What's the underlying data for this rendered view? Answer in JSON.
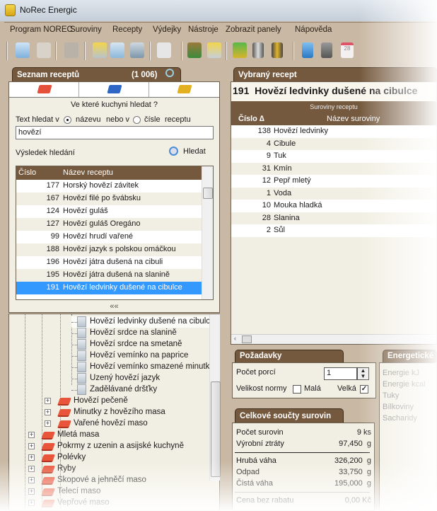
{
  "window": {
    "title": "NoRec Energic"
  },
  "menu": [
    "Program NOREC",
    "Suroviny",
    "Recepty",
    "Výdejky",
    "Nástroje",
    "Zobrazit panely",
    "Nápověda"
  ],
  "toolbar": {
    "icons": [
      "import-icon",
      "preview-icon",
      "print-check-icon",
      "jar-refresh-icon",
      "doc-import-icon",
      "jar-upload-icon",
      "printer-check-icon",
      "vegetables-icon",
      "jar-check-icon",
      "money-icon",
      "battery-check-icon",
      "battery-icon",
      "calculator-blue-icon",
      "calculator-gray-icon",
      "calendar-icon"
    ],
    "calendar_day": "28"
  },
  "left": {
    "title": "Seznam receptů",
    "count": "(1 006)",
    "kitchen_question": "Ve které kuchyni hledat ?",
    "search_in_label": "Text hledat v",
    "radio_name": "názevu",
    "or_label": "nebo v",
    "radio_number": "čísle",
    "recipe_word": "receptu",
    "search_value": "hovězí",
    "results_label": "Výsledek hledání",
    "search_button": "Hledat",
    "columns": [
      "Číslo",
      "Název receptu"
    ],
    "results": [
      {
        "num": "177",
        "name": "Horský hovězí závitek"
      },
      {
        "num": "167",
        "name": "Hovězí filé po švábsku"
      },
      {
        "num": "124",
        "name": "Hovězí guláš"
      },
      {
        "num": "127",
        "name": "Hovězí guláš Oregáno"
      },
      {
        "num": "99",
        "name": "Hovězí hrudí vařené"
      },
      {
        "num": "188",
        "name": "Hovězí jazyk s polskou omáčkou"
      },
      {
        "num": "196",
        "name": "Hovězí játra dušená na cibuli"
      },
      {
        "num": "195",
        "name": "Hovězí játra dušená na slanině"
      },
      {
        "num": "191",
        "name": "Hovězí ledvinky dušené na cibulce"
      }
    ],
    "collapse": "««",
    "tree_recipes": [
      "Hovězí ledvinky dušené na cibulce",
      "Hovězí srdce na slanině",
      "Hovězí srdce na smetaně",
      "Hovězí vemínko na paprice",
      "Hovězí vemínko smazené minutka",
      "Uzený hovězí jazyk",
      "Zadělávané dršťky"
    ],
    "tree_sub": [
      "Hovězí pečeně",
      "Minutky z hovězího masa",
      "Vařené hovězí maso"
    ],
    "tree_top": [
      "Mletá masa",
      "Pokrmy z uzenin a asijské kuchyně",
      "Polévky",
      "Ryby",
      "Skopové a jehněčí maso",
      "Telecí maso",
      "Vepřové maso"
    ]
  },
  "right": {
    "title": "Vybraný recept",
    "recipe_number": "191",
    "recipe_name": "Hovězí ledvinky dušené na cibulce",
    "grid_caption": "Suroviny receptu",
    "columns": [
      "Číslo ∆",
      "Název suroviny"
    ],
    "ingredients": [
      {
        "num": "138",
        "name": "Hovězí ledvinky"
      },
      {
        "num": "4",
        "name": "Cibule"
      },
      {
        "num": "9",
        "name": "Tuk"
      },
      {
        "num": "31",
        "name": "Kmín"
      },
      {
        "num": "12",
        "name": "Pepř mletý"
      },
      {
        "num": "1",
        "name": "Voda"
      },
      {
        "num": "10",
        "name": "Mouka hladká"
      },
      {
        "num": "28",
        "name": "Slanina"
      },
      {
        "num": "2",
        "name": "Sůl"
      }
    ],
    "requirements": {
      "title": "Požadavky",
      "portions_label": "Počet porcí",
      "portions": "1",
      "norm_label": "Velikost normy",
      "small": "Malá",
      "small_checked": false,
      "big": "Velká",
      "big_checked": true
    },
    "totals": {
      "title": "Celkové součty surovin",
      "rows": [
        {
          "label": "Počet surovin",
          "value": "9 ks"
        },
        {
          "label": "Výrobní ztráty",
          "value": "97,450  g"
        },
        {
          "label": "Hrubá váha",
          "value": "326,200  g"
        },
        {
          "label": "Odpad",
          "value": "33,750  g"
        },
        {
          "label": "Čistá váha",
          "value": "195,000  g"
        },
        {
          "label": "Cena bez rabatu",
          "value": "0,00 Kč"
        }
      ]
    },
    "energy": {
      "title": "Energetické",
      "rows": [
        "Energie kJ",
        "Energie kcal",
        "Tuky",
        "Bílkoviny",
        "Sacharidy"
      ]
    }
  }
}
